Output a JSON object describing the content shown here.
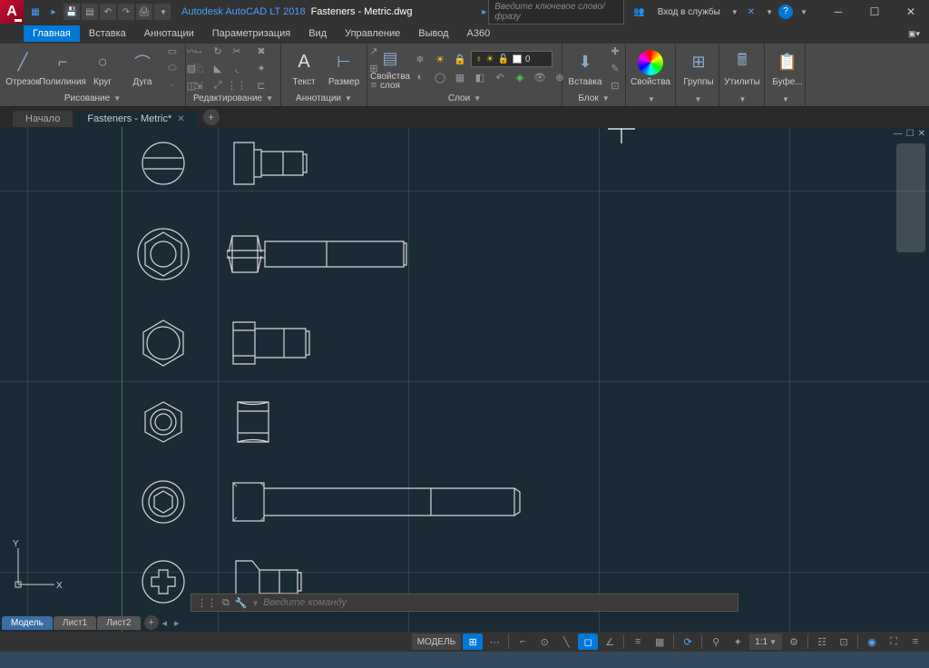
{
  "title": {
    "app": "Autodesk AutoCAD LT 2018",
    "file": "Fasteners - Metric.dwg"
  },
  "search": {
    "placeholder": "Введите ключевое слово/фразу"
  },
  "signin": "Вход в службы",
  "menu": [
    "Главная",
    "Вставка",
    "Аннотации",
    "Параметризация",
    "Вид",
    "Управление",
    "Вывод",
    "A360"
  ],
  "ribbon": {
    "draw": {
      "line": "Отрезок",
      "polyline": "Полилиния",
      "circle": "Круг",
      "arc": "Дуга",
      "title": "Рисование"
    },
    "edit": {
      "title": "Редактирование"
    },
    "annot": {
      "text": "Текст",
      "dim": "Размер",
      "title": "Аннотации"
    },
    "layers": {
      "props": "Свойства\nслоя",
      "title": "Слои",
      "current": "0"
    },
    "block": {
      "insert": "Вставка",
      "title": "Блок"
    },
    "props": {
      "title": "Свойства"
    },
    "groups": {
      "title": "Группы"
    },
    "utils": {
      "title": "Утилиты"
    },
    "clip": {
      "title": "Буфе..."
    }
  },
  "tabs": {
    "start": "Начало",
    "file": "Fasteners - Metric*"
  },
  "cmd": {
    "placeholder": "Введите команду"
  },
  "btabs": {
    "model": "Модель",
    "l1": "Лист1",
    "l2": "Лист2"
  },
  "status": {
    "model": "МОДЕЛЬ",
    "scale": "1:1"
  },
  "ucs": {
    "x": "X",
    "y": "Y"
  }
}
